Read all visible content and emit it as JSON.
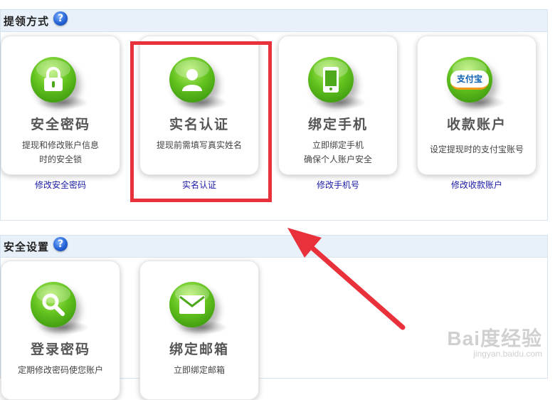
{
  "sections": {
    "pickup": {
      "title": "提领方式",
      "help": "?",
      "cards": [
        {
          "title": "安全密码",
          "desc1": "提现和修改账户信息",
          "desc2": "时的安全锁",
          "link": "修改安全密码",
          "icon": "lock-icon"
        },
        {
          "title": "实名认证",
          "desc1": "提现前需填写真实姓名",
          "desc2": "",
          "link": "实名认证",
          "icon": "user-icon"
        },
        {
          "title": "绑定手机",
          "desc1": "立即绑定手机",
          "desc2": "确保个人账户安全",
          "link": "修改手机号",
          "icon": "phone-icon"
        },
        {
          "title": "收款账户",
          "desc1": "设定提现时的支付宝账号",
          "desc2": "",
          "link": "修改收款账户",
          "icon": "alipay-logo",
          "logo_text": "支付宝"
        }
      ]
    },
    "security": {
      "title": "安全设置",
      "help": "?",
      "cards": [
        {
          "title": "登录密码",
          "desc1": "定期修改密码使您账户",
          "icon": "magnifier-icon"
        },
        {
          "title": "绑定邮箱",
          "desc1": "立即绑定邮箱",
          "icon": "envelope-icon"
        }
      ]
    }
  },
  "watermark": {
    "brand": "Bai度经验",
    "url": "jingyan.baidu.com"
  },
  "colors": {
    "highlight": "#e8313a",
    "arrow": "#e8313a",
    "link": "#1a1aa6",
    "header_bg": "#e8f1f9"
  }
}
